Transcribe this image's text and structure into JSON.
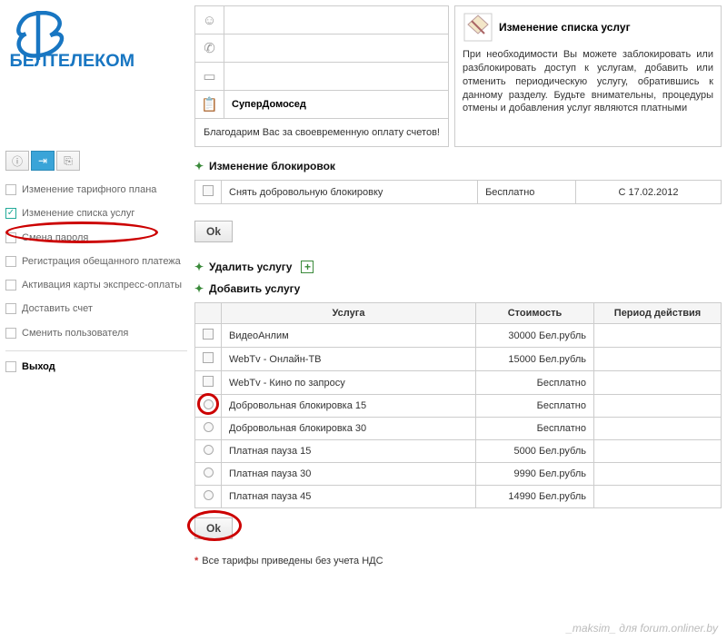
{
  "logo_text": "БЕЛТЕЛЕКОМ",
  "top_box": {
    "row_banner_label": "СуперДомосед",
    "thanks": "Благодарим Вас за своевременную оплату счетов!"
  },
  "info": {
    "title": "Изменение списка услуг",
    "body": "При необходимости Вы можете заблокировать или разблокировать доступ к услугам, добавить или отменить периодическую услугу, обратившись к данному разделу. Будьте внимательны, процедуры отмены и добавления услуг являются платными"
  },
  "sidebar": {
    "items": [
      {
        "label": "Изменение тарифного плана",
        "checked": false
      },
      {
        "label": "Изменение списка услуг",
        "checked": true
      },
      {
        "label": "Смена пароля",
        "checked": false
      },
      {
        "label": "Регистрация обещанного платежа",
        "checked": false
      },
      {
        "label": "Активация карты экспресс-оплаты",
        "checked": false
      },
      {
        "label": "Доставить счет",
        "checked": false
      },
      {
        "label": "Сменить пользователя",
        "checked": false
      }
    ],
    "exit": "Выход"
  },
  "sections": {
    "blocks_title": "Изменение блокировок",
    "block_row": {
      "name": "Снять добровольную блокировку",
      "cost": "Бесплатно",
      "since": "С 17.02.2012"
    },
    "ok": "Ok",
    "remove_title": "Удалить услугу",
    "add_title": "Добавить услугу"
  },
  "services_table": {
    "headers": {
      "name": "Услуга",
      "cost": "Стоимость",
      "period": "Период действия"
    },
    "rows": [
      {
        "type": "chk",
        "name": "ВидеоАнлим",
        "cost": "30000 Бел.рубль",
        "period": ""
      },
      {
        "type": "chk",
        "name": "WebTv - Онлайн-ТВ",
        "cost": "15000 Бел.рубль",
        "period": ""
      },
      {
        "type": "chk",
        "name": "WebTv - Кино по запросу",
        "cost": "Бесплатно",
        "period": ""
      },
      {
        "type": "rad",
        "name": "Добровольная блокировка 15",
        "cost": "Бесплатно",
        "period": "",
        "circled": true
      },
      {
        "type": "rad",
        "name": "Добровольная блокировка 30",
        "cost": "Бесплатно",
        "period": ""
      },
      {
        "type": "rad",
        "name": "Платная пауза 15",
        "cost": "5000 Бел.рубль",
        "period": ""
      },
      {
        "type": "rad",
        "name": "Платная пауза 30",
        "cost": "9990 Бел.рубль",
        "period": ""
      },
      {
        "type": "rad",
        "name": "Платная пауза 45",
        "cost": "14990 Бел.рубль",
        "period": ""
      }
    ]
  },
  "footnote": "Все тарифы приведены без учета НДС",
  "watermark": "_maksim_ для forum.onliner.by"
}
